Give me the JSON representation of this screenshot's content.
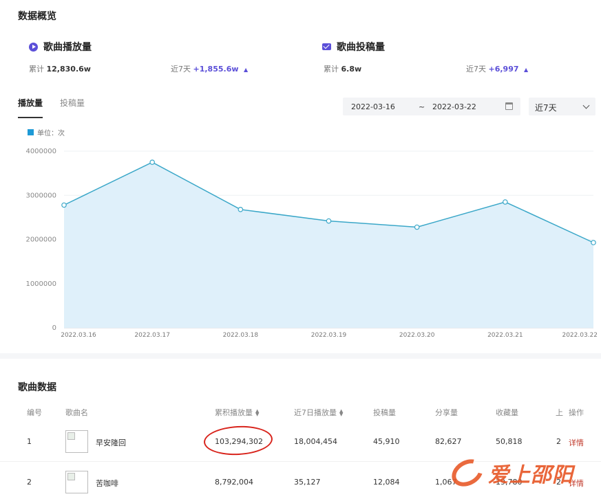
{
  "overview": {
    "title": "数据概览",
    "play_card": {
      "title": "歌曲播放量",
      "total_label": "累计",
      "total_value": "12,830.6w",
      "recent_label": "近7天",
      "recent_value": "+1,855.6w",
      "trend_icon": "up-triangle"
    },
    "submit_card": {
      "title": "歌曲投稿量",
      "total_label": "累计",
      "total_value": "6.8w",
      "recent_label": "近7天",
      "recent_value": "+6,997",
      "trend_icon": "up-triangle"
    }
  },
  "tabs": [
    "播放量",
    "投稿量"
  ],
  "date_range": {
    "start": "2022-03-16",
    "separator": "~",
    "end": "2022-03-22"
  },
  "period_select": {
    "selected": "近7天"
  },
  "colors": {
    "accent": "#5b4fd8",
    "line": "#3aa7c8",
    "area": "#dff0fa",
    "legend": "#1e9ad6",
    "annotation": "#d8231b",
    "watermark": "#e85a2a"
  },
  "chart_data": {
    "type": "area",
    "legend": "单位：次",
    "x": [
      "2022.03.16",
      "2022.03.17",
      "2022.03.18",
      "2022.03.19",
      "2022.03.20",
      "2022.03.21",
      "2022.03.22"
    ],
    "series": [
      {
        "values": [
          2780000,
          3750000,
          2680000,
          2420000,
          2280000,
          2850000,
          1930000
        ]
      }
    ],
    "yticks": [
      "0",
      "1000000",
      "2000000",
      "3000000",
      "4000000"
    ],
    "ylim": [
      0,
      4000000
    ],
    "grid": true
  },
  "songs": {
    "title": "歌曲数据",
    "columns": [
      "编号",
      "歌曲名",
      "累积播放量",
      "近7日播放量",
      "投稿量",
      "分享量",
      "收藏量",
      "上",
      "操作"
    ],
    "rows": [
      {
        "no": "1",
        "name": "早安隆回",
        "total_plays": "103,294,302",
        "plays_7d": "18,004,454",
        "submissions": "45,910",
        "shares": "82,627",
        "favorites": "50,818",
        "partial": "2",
        "action": "详情"
      },
      {
        "no": "2",
        "name": "苦咖啡",
        "total_plays": "8,792,004",
        "plays_7d": "35,127",
        "submissions": "12,084",
        "shares": "1,067",
        "favorites": "19,780",
        "partial": "2",
        "action": "详情"
      }
    ]
  },
  "watermark": {
    "text": "爱上邵阳"
  }
}
